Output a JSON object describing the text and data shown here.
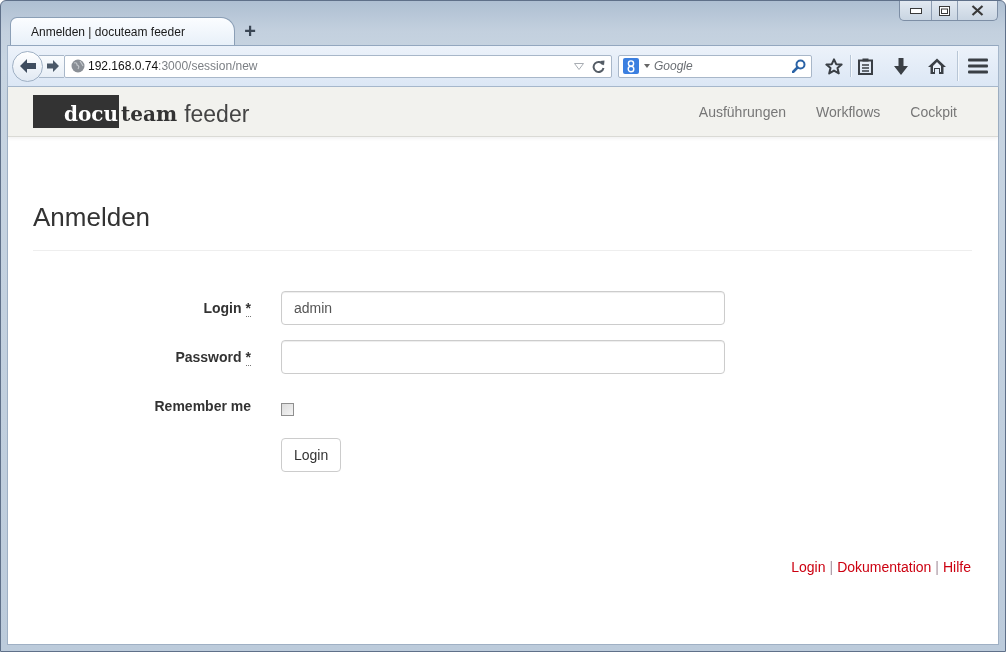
{
  "browser": {
    "tabs": [
      {
        "title": "Anmelden | docuteam feeder",
        "selected": true
      }
    ],
    "new_tab": "+",
    "address_bar": {
      "host": "192.168.0.74",
      "path": ":3000/session/new"
    },
    "search": {
      "placeholder": "Google"
    }
  },
  "page": {
    "brand": {
      "highlight": "docu",
      "rest": "team",
      "product": "feeder"
    },
    "nav": [
      "Ausführungen",
      "Workflows",
      "Cockpit"
    ],
    "heading": "Anmelden",
    "form": {
      "fields": [
        {
          "kind": "text",
          "label": "Login",
          "required_mark": "*",
          "value": "admin"
        },
        {
          "kind": "password",
          "label": "Password",
          "required_mark": "*"
        },
        {
          "kind": "checkbox",
          "label": "Remember me",
          "checked": false
        }
      ],
      "submit": "Login"
    },
    "footer": [
      {
        "kind": "link",
        "text": "Login"
      },
      {
        "kind": "separator",
        "text": "|"
      },
      {
        "kind": "link",
        "text": "Dokumentation"
      },
      {
        "kind": "separator",
        "text": "|"
      },
      {
        "kind": "link",
        "text": "Hilfe"
      }
    ]
  }
}
